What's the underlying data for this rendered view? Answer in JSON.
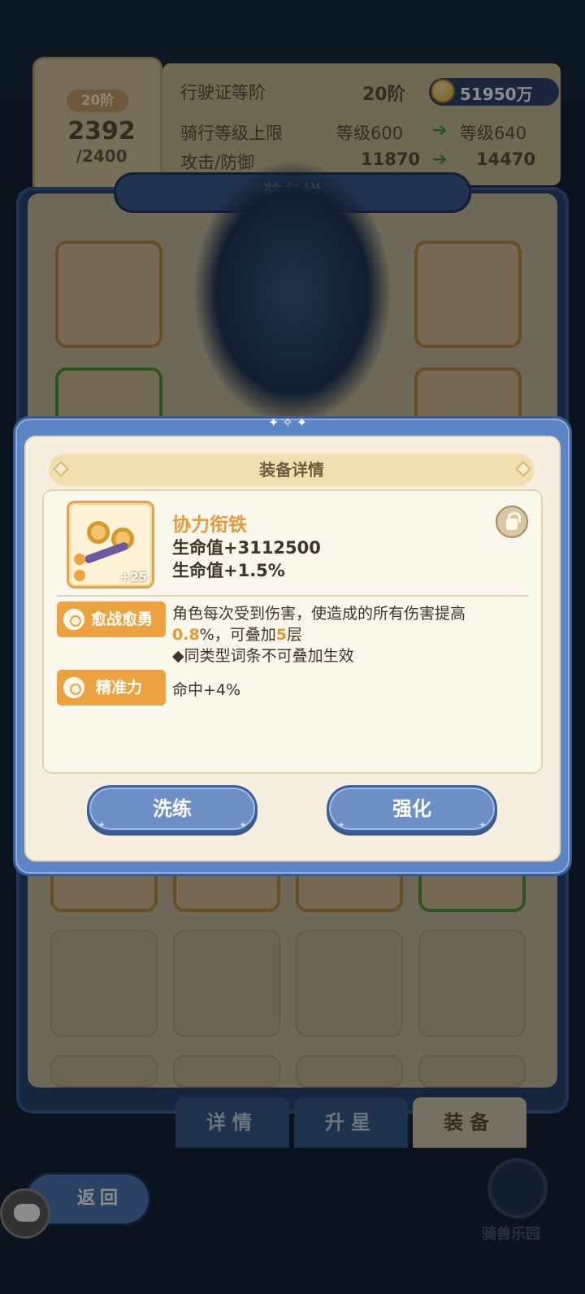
{
  "license": {
    "rank_badge": "20阶",
    "progress_current": "2392",
    "progress_total": "/2400",
    "rows": [
      {
        "label": "行驶证等阶",
        "value": "20阶",
        "next": ""
      },
      {
        "label": "骑行等级上限",
        "value": "等级600",
        "next": "等级640"
      },
      {
        "label": "攻击/防御",
        "value": "11870",
        "next": "14470"
      }
    ]
  },
  "currency": {
    "amount": "51950万",
    "icon": "coin-icon"
  },
  "equip_panel": {
    "title": "装备栏",
    "slot_bonus": "+25"
  },
  "tabs": [
    {
      "label": "详情",
      "active": false
    },
    {
      "label": "升星",
      "active": false
    },
    {
      "label": "装备",
      "active": true
    }
  ],
  "back_button": {
    "label": "返回"
  },
  "logo_text": "骑兽乐园",
  "modal": {
    "title": "装备详情",
    "item": {
      "name": "协力衔铁",
      "level_badge": "+25",
      "stats": [
        "生命值+3112500",
        "生命值+1.5%"
      ]
    },
    "affixes": [
      {
        "tag": "愈战愈勇",
        "desc_line1": "角色每次受到伤害，使造成的所有伤害提高",
        "desc_value": "0.8",
        "desc_mid": "%，可叠加",
        "desc_stack": "5",
        "desc_end": "层",
        "desc_note": "◆同类型词条不可叠加生效"
      },
      {
        "tag": "精准力",
        "desc_line1": "命中+4%"
      }
    ],
    "buttons": {
      "refine": "洗练",
      "enhance": "强化"
    }
  },
  "colors": {
    "accent_orange": "#eca23f",
    "modal_blue": "#5d84c4",
    "panel_cream": "#f6efdf"
  }
}
